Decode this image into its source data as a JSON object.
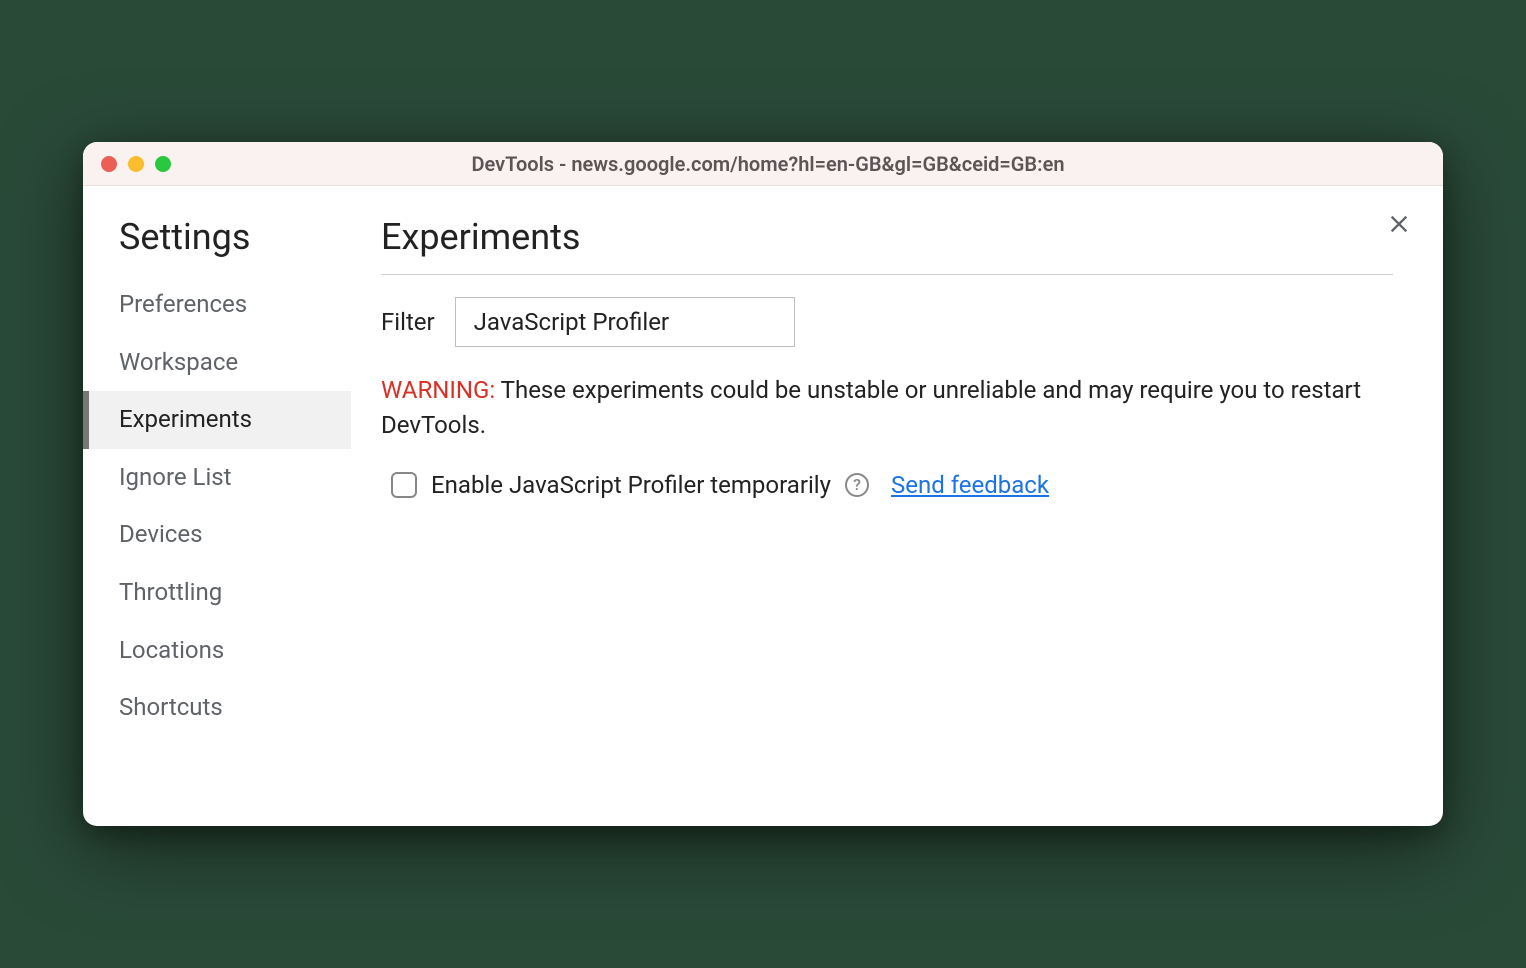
{
  "window": {
    "title": "DevTools - news.google.com/home?hl=en-GB&gl=GB&ceid=GB:en"
  },
  "sidebar": {
    "title": "Settings",
    "items": [
      {
        "label": "Preferences",
        "active": false
      },
      {
        "label": "Workspace",
        "active": false
      },
      {
        "label": "Experiments",
        "active": true
      },
      {
        "label": "Ignore List",
        "active": false
      },
      {
        "label": "Devices",
        "active": false
      },
      {
        "label": "Throttling",
        "active": false
      },
      {
        "label": "Locations",
        "active": false
      },
      {
        "label": "Shortcuts",
        "active": false
      }
    ]
  },
  "main": {
    "heading": "Experiments",
    "filter_label": "Filter",
    "filter_value": "JavaScript Profiler",
    "warning_prefix": "WARNING:",
    "warning_text": " These experiments could be unstable or unreliable and may require you to restart DevTools.",
    "experiments": [
      {
        "checked": false,
        "label": "Enable JavaScript Profiler temporarily",
        "has_help": true,
        "feedback_label": "Send feedback"
      }
    ]
  }
}
